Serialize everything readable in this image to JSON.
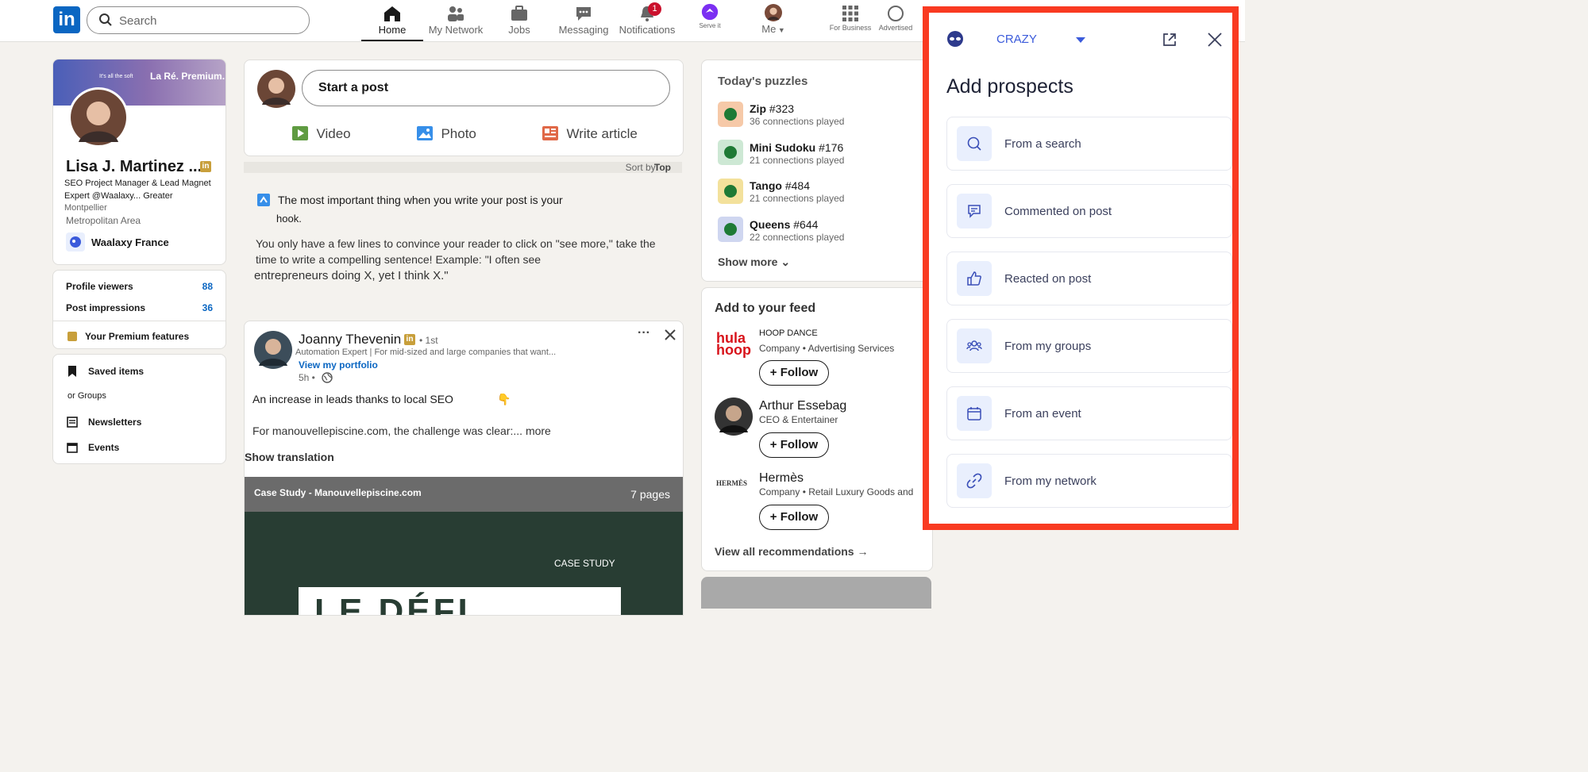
{
  "nav": {
    "search_placeholder": "Search",
    "items": [
      {
        "label": "Home"
      },
      {
        "label": "My Network"
      },
      {
        "label": "Jobs"
      },
      {
        "label": "Messaging"
      },
      {
        "label": "Notifications",
        "badge": "1"
      },
      {
        "label": "Serve it"
      },
      {
        "label": "Me"
      },
      {
        "label": "For Business"
      },
      {
        "label": "Advertised"
      }
    ]
  },
  "profile": {
    "banner_text": "La Ré. Premium.",
    "banner_small": "It's all the soft",
    "name": "Lisa J. Martinez ...",
    "headline": "SEO Project Manager & Lead Magnet Expert @Waalaxy... Greater",
    "location1": "Montpellier",
    "location2": "Metropolitan Area",
    "company": "Waalaxy France",
    "viewers_label": "Profile viewers",
    "viewers_value": "88",
    "impressions_label": "Post impressions",
    "impressions_value": "36",
    "premium_label": "Your Premium features",
    "saved": "Saved items",
    "groups": "or Groups",
    "newsletters": "Newsletters",
    "events": "Events"
  },
  "composer": {
    "start": "Start a post",
    "video": "Video",
    "photo": "Photo",
    "article": "Write article",
    "sort_label": "Sort by:",
    "sort_value": "Top"
  },
  "tip": {
    "line1": "The most important thing when you write your post is your",
    "line2": "hook.",
    "p1": "You only have a few lines to convince your reader to click on \"see more,\" take the",
    "p2": "time to write a compelling sentence! Example: \"I often see",
    "p3": "entrepreneurs doing X, yet I think X.\""
  },
  "post": {
    "author": "Joanny Thevenin",
    "degree": "• 1st",
    "headline": "Automation Expert | For mid-sized and large companies that want...",
    "portfolio": "View my portfolio",
    "time": "5h •",
    "text1": "An increase in leads thanks to local SEO",
    "emoji": "👇",
    "text2": "For manouvellepiscine.com, the challenge was clear:... more",
    "translate": "Show translation",
    "doc_title": "Case Study - Manouvellepiscine.com",
    "doc_pages": "7 pages",
    "case": "CASE STUDY",
    "big": "LE DÉFI"
  },
  "puzzles": {
    "title": "Today's puzzles",
    "items": [
      {
        "name": "Zip",
        "num": "#323",
        "sub": "36 connections played",
        "color": "#f6c9a8"
      },
      {
        "name": "Mini Sudoku",
        "num": "#176",
        "sub": "21 connections played",
        "color": "#cde8d4"
      },
      {
        "name": "Tango",
        "num": "#484",
        "sub": "21 connections played",
        "color": "#f3e19c"
      },
      {
        "name": "Queens",
        "num": "#644",
        "sub": "22 connections played",
        "color": "#cfd6f0"
      }
    ],
    "more": "Show more"
  },
  "feed": {
    "title": "Add to your feed",
    "items": [
      {
        "name": "HOOP DANCE",
        "sub": "Company • Advertising Services",
        "follow": "Follow"
      },
      {
        "name": "Arthur Essebag",
        "sub": "CEO & Entertainer",
        "follow": "Follow"
      },
      {
        "name": "Hermès",
        "sub": "Company • Retail Luxury Goods and",
        "follow": "Follow"
      }
    ],
    "all": "View all recommendations",
    "hula": "hula hoop",
    "hermes_logo": "HERMÈS"
  },
  "panel": {
    "account": "CRAZY",
    "title": "Add prospects",
    "options": [
      {
        "label": "From a search",
        "icon": "search-icon"
      },
      {
        "label": "Commented on post",
        "icon": "comment-icon"
      },
      {
        "label": "Reacted on post",
        "icon": "thumbs-up-icon"
      },
      {
        "label": "From my groups",
        "icon": "groups-icon"
      },
      {
        "label": "From an event",
        "icon": "calendar-icon"
      },
      {
        "label": "From my network",
        "icon": "link-icon"
      }
    ],
    "accent": "#f93a21",
    "brand": "#3b5bdb"
  }
}
